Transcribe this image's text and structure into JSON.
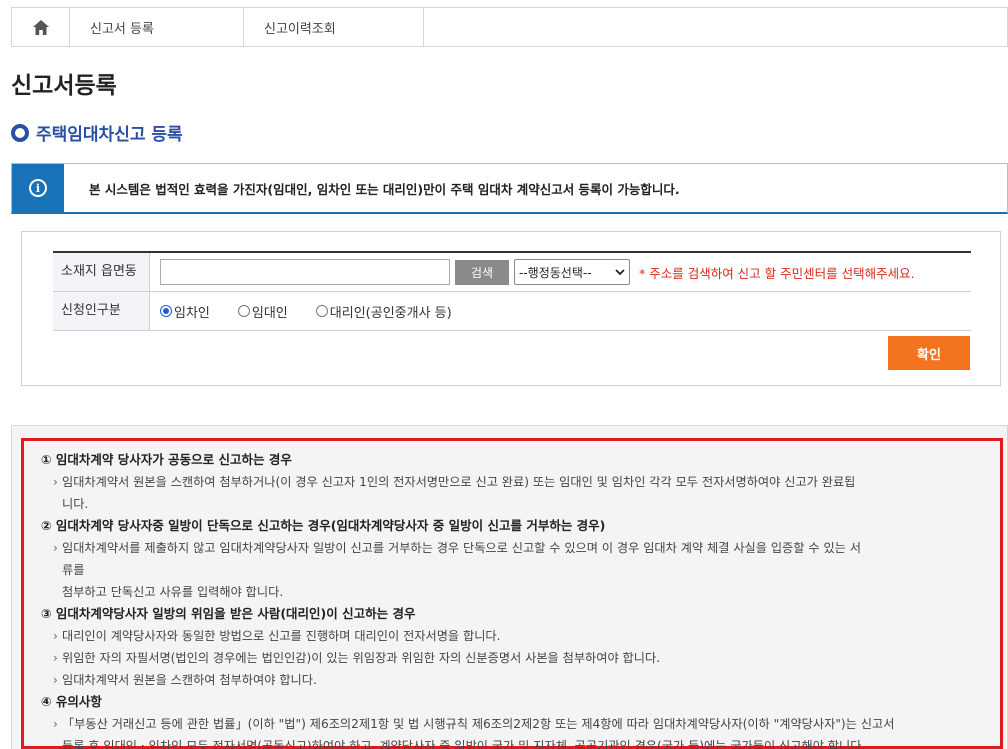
{
  "nav": {
    "crumbs": [
      "신고서 등록",
      "신고이력조회"
    ]
  },
  "page_title": "신고서등록",
  "section_title": "주택임대차신고 등록",
  "notice": {
    "icon": "info-icon",
    "text": "본 시스템은 법적인 효력을 가진자(임대인, 임차인 또는 대리인)만이 주택 임대차 계약신고서 등록이 가능합니다."
  },
  "form": {
    "location_label": "소재지 읍면동",
    "search_button": "검색",
    "district_select": "--행정동선택--",
    "hint": "* 주소를 검색하여 신고 할 주민센터를 선택해주세요.",
    "applicant_label": "신청인구분",
    "radios": [
      "임차인",
      "임대인",
      "대리인(공인중개사 등)"
    ],
    "selected_radio": "임차인",
    "confirm_button": "확인"
  },
  "guide": {
    "sections": [
      {
        "heading": "① 임대차계약 당사자가 공동으로 신고하는 경우",
        "items": [
          [
            "임대차계약서 원본을 스캔하여 첨부하거나(이 경우 신고자 1인의 전자서명만으로 신고 완료) 또는 임대인 및 임차인 각각 모두 전자서명하여야 신고가 완료됩",
            "니다."
          ]
        ]
      },
      {
        "heading": "② 임대차계약 당사자중 일방이 단독으로 신고하는 경우(임대차계약당사자 중 일방이 신고를 거부하는 경우)",
        "items": [
          [
            "임대차계약서를 제출하지 않고 임대차계약당사자 일방이 신고를 거부하는 경우 단독으로 신고할 수 있으며 이 경우 임대차 계약 체결 사실을 입증할 수 있는 서",
            "류를",
            "첨부하고 단독신고 사유를 입력해야 합니다."
          ]
        ]
      },
      {
        "heading": "③ 임대차계약당사자 일방의 위임을 받은 사람(대리인)이 신고하는 경우",
        "items": [
          [
            "대리인이 계약당사자와 동일한 방법으로 신고를 진행하며 대리인이 전자서명을 합니다."
          ],
          [
            "위임한 자의 자필서명(법인의 경우에는 법인인감)이 있는 위임장과 위임한 자의 신분증명서 사본을 첨부하여야 합니다."
          ],
          [
            "임대차계약서 원본을 스캔하여 첨부하여야 합니다."
          ]
        ]
      },
      {
        "heading": "④ 유의사항",
        "items": [
          [
            "「부동산 거래신고 등에 관한 법률」(이하 \"법\") 제6조의2제1항 및 법 시행규칙 제6조의2제2항 또는 제4항에 따라 임대차계약당사자(이하 \"계약당사자\")는 신고서",
            "등록 후 임대인 · 임차인 모두 전자서명(공동신고)하여야 하고, 계약당사자 중 일방이 국가 및 지자체, 공공기관인 경우(국가 등)에는 국가등이 신고해야 합니다."
          ]
        ]
      }
    ]
  }
}
